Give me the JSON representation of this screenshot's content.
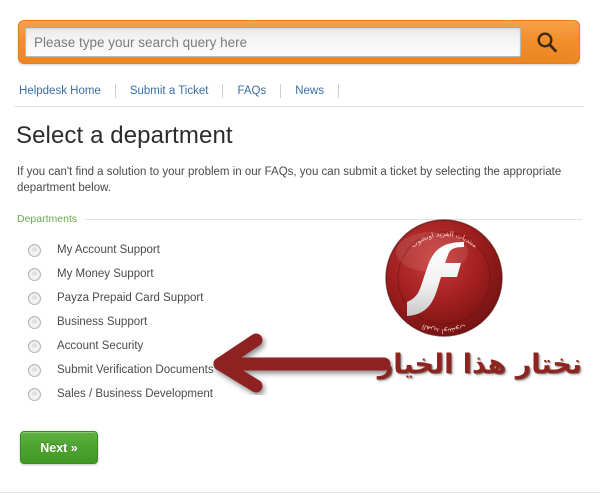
{
  "search": {
    "placeholder": "Please type your search query here",
    "value": "",
    "button_icon": "search-icon"
  },
  "nav": {
    "items": [
      {
        "label": "Helpdesk Home"
      },
      {
        "label": "Submit a Ticket"
      },
      {
        "label": "FAQs"
      },
      {
        "label": "News"
      }
    ]
  },
  "main": {
    "title": "Select a department",
    "description": "If you can't find a solution to your problem in our FAQs, you can submit a ticket by selecting the appropriate department below.",
    "legend": "Departments",
    "departments": [
      {
        "label": "My Account Support",
        "selected": false
      },
      {
        "label": "My Money Support",
        "selected": false
      },
      {
        "label": "Payza Prepaid Card Support",
        "selected": false
      },
      {
        "label": "Business Support",
        "selected": false
      },
      {
        "label": "Account Security",
        "selected": false
      },
      {
        "label": "Submit Verification Documents",
        "selected": false
      },
      {
        "label": "Sales / Business Development",
        "selected": false
      }
    ],
    "next_label": "Next »"
  },
  "annotations": {
    "arabic_note": "نختار هذا الخيار",
    "flash_logo": {
      "glyph": "f",
      "rim_top_text": "منتديات الفريد اونشوب",
      "rim_bottom_text": "الفريد اونشوب"
    }
  },
  "colors": {
    "orange": "#ec8622",
    "green_button": "#4da22f",
    "green_legend": "#6aa84f",
    "link_blue": "#3a6ea5",
    "annotation_red": "#8e2420",
    "logo_red": "#9c1d1d"
  }
}
